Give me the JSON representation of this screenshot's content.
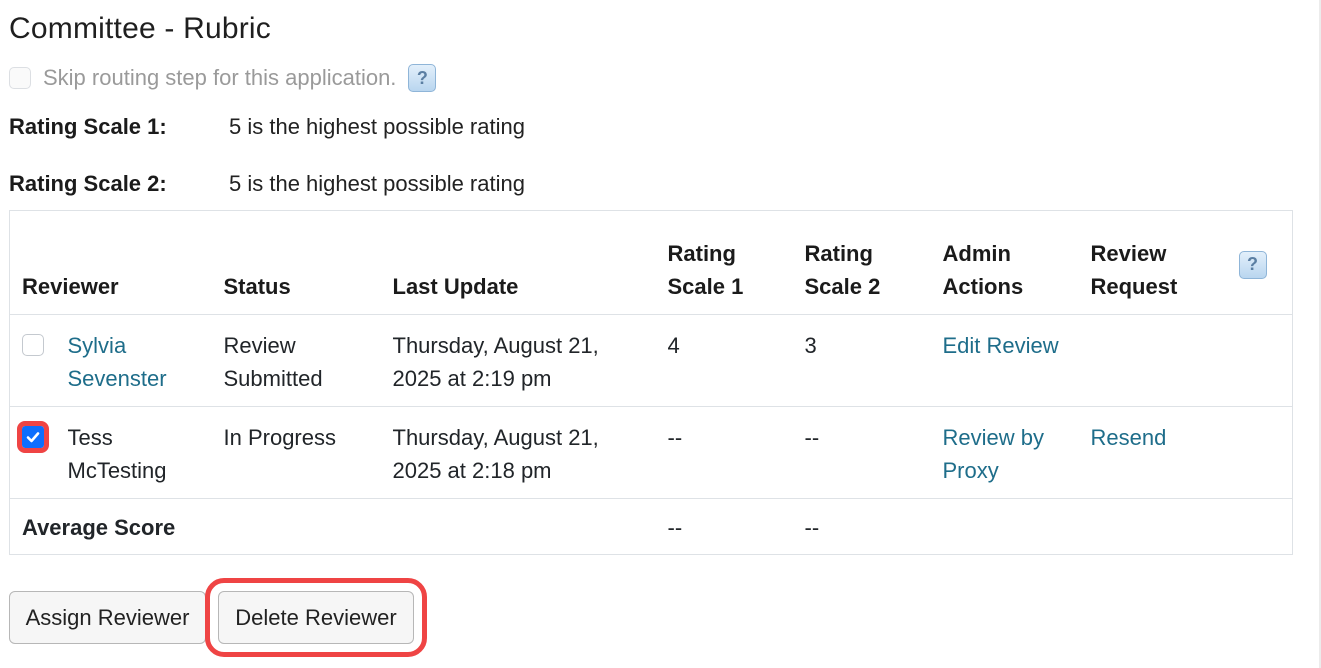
{
  "page": {
    "title": "Committee - Rubric"
  },
  "skip_routing": {
    "label": "Skip routing step for this application.",
    "checked": false
  },
  "help_icon_glyph": "?",
  "rating_scales": [
    {
      "label": "Rating Scale 1:",
      "value": "5 is the highest possible rating"
    },
    {
      "label": "Rating Scale 2:",
      "value": "5 is the highest possible rating"
    }
  ],
  "table": {
    "headers": {
      "reviewer": "Reviewer",
      "status": "Status",
      "last_update": "Last Update",
      "scale1_line1": "Rating",
      "scale1_line2": "Scale 1",
      "scale2_line1": "Rating",
      "scale2_line2": "Scale 2",
      "admin_line1": "Admin",
      "admin_line2": "Actions",
      "request_line1": "Review",
      "request_line2": "Request"
    },
    "rows": [
      {
        "selected": false,
        "reviewer_line1": "Sylvia",
        "reviewer_line2": "Sevenster",
        "status_line1": "Review",
        "status_line2": "Submitted",
        "date_line1": "Thursday, August 21,",
        "date_line2": "2025 at 2:19 pm",
        "scale1": "4",
        "scale2": "3",
        "admin_action": "Edit Review",
        "admin_action_line2": "",
        "review_request": ""
      },
      {
        "selected": true,
        "reviewer_line1": "Tess",
        "reviewer_line2": "McTesting",
        "status_line1": "In Progress",
        "status_line2": "",
        "date_line1": "Thursday, August 21,",
        "date_line2": "2025 at 2:18 pm",
        "scale1": "--",
        "scale2": "--",
        "admin_action": "Review by",
        "admin_action_line2": "Proxy",
        "review_request": "Resend"
      }
    ],
    "average": {
      "label": "Average Score",
      "scale1": "--",
      "scale2": "--"
    }
  },
  "buttons": {
    "assign": "Assign Reviewer",
    "delete": "Delete Reviewer"
  },
  "colors": {
    "link": "#1e6d8a",
    "highlight": "#ef4444",
    "checkbox_checked": "#0d6efd"
  }
}
